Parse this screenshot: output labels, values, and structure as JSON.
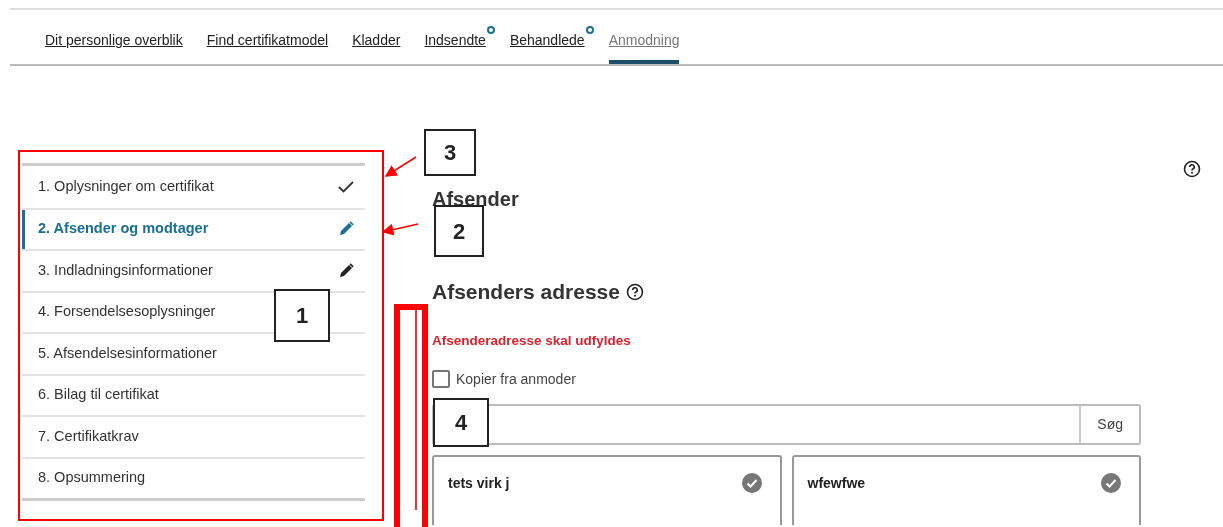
{
  "tabs": [
    {
      "label": "Dit personlige overblik",
      "selected": false,
      "dot": false
    },
    {
      "label": "Find certifikatmodel",
      "selected": false,
      "dot": false
    },
    {
      "label": "Kladder",
      "selected": false,
      "dot": false
    },
    {
      "label": "Indsendte",
      "selected": false,
      "dot": true
    },
    {
      "label": "Behandlede",
      "selected": false,
      "dot": true
    },
    {
      "label": "Anmodning",
      "selected": true,
      "dot": false
    }
  ],
  "steps": [
    {
      "label": "1. Oplysninger om certifikat",
      "selected": false,
      "completed": true,
      "editing": false
    },
    {
      "label": "2. Afsender og modtager",
      "selected": true,
      "completed": false,
      "editing": true
    },
    {
      "label": "3. Indladningsinformationer",
      "selected": false,
      "completed": false,
      "editing": true
    },
    {
      "label": "4. Forsendelsesoplysninger",
      "selected": false,
      "completed": false,
      "editing": false
    },
    {
      "label": "5. Afsendelsesinformationer",
      "selected": false,
      "completed": false,
      "editing": false
    },
    {
      "label": "6. Bilag til certifikat",
      "selected": false,
      "completed": false,
      "editing": false
    },
    {
      "label": "7. Certifikatkrav",
      "selected": false,
      "completed": false,
      "editing": false
    },
    {
      "label": "8. Opsummering",
      "selected": false,
      "completed": false,
      "editing": false
    }
  ],
  "main": {
    "title": "Afsender",
    "section_title": "Afsenders adresse",
    "error": "Afsenderadresse skal udfyldes",
    "copy_checkbox": {
      "label": "Kopier fra anmoder",
      "checked": false
    },
    "search_button": "Søg",
    "addresses": [
      {
        "name": "tets virk j",
        "selected": true
      },
      {
        "name": "wfewfwe",
        "selected": true
      }
    ]
  },
  "callouts": [
    {
      "label": "3"
    },
    {
      "label": "2"
    },
    {
      "label": "1"
    },
    {
      "label": "4"
    }
  ]
}
